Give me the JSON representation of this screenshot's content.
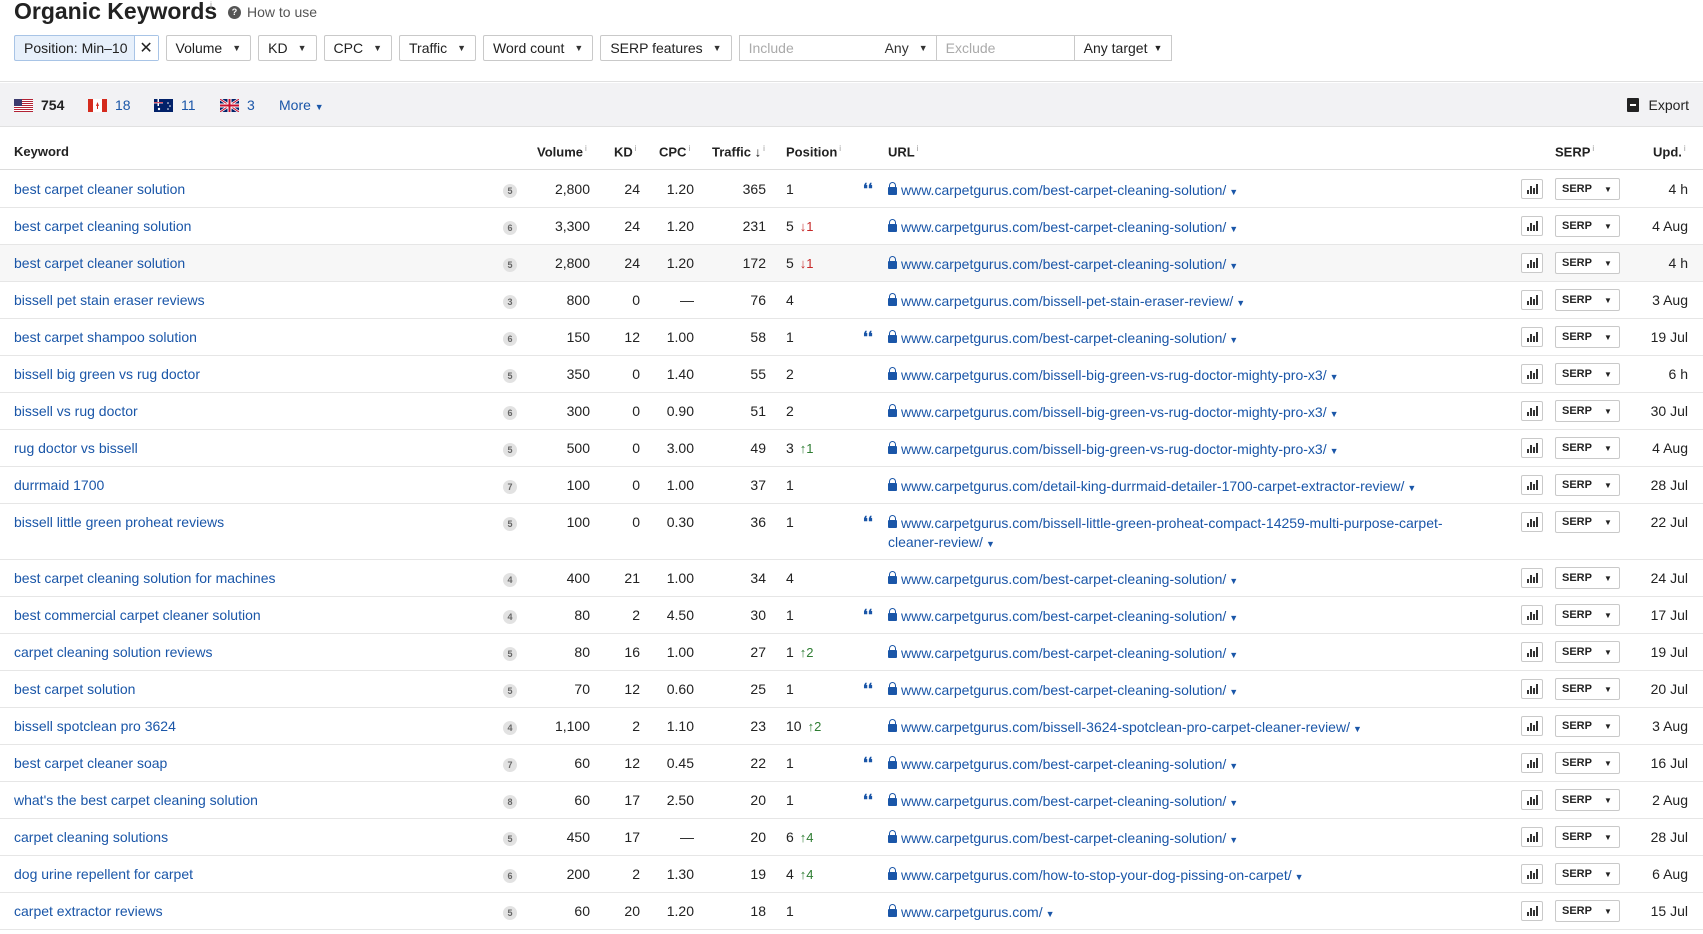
{
  "header": {
    "title": "Organic Keywords",
    "title_sup": "i",
    "how_to_use": "How to use"
  },
  "filters": {
    "position": "Position: Min–10",
    "volume": "Volume",
    "kd": "KD",
    "cpc": "CPC",
    "traffic": "Traffic",
    "word_count": "Word count",
    "serp_features": "SERP features",
    "include_placeholder": "Include",
    "include_mode": "Any",
    "exclude_placeholder": "Exclude",
    "target": "Any target"
  },
  "countries": [
    {
      "code": "US",
      "count": "754"
    },
    {
      "code": "CA",
      "count": "18"
    },
    {
      "code": "AU",
      "count": "11"
    },
    {
      "code": "GB",
      "count": "3"
    }
  ],
  "more_label": "More",
  "export_label": "Export",
  "columns": {
    "keyword": "Keyword",
    "volume": "Volume",
    "kd": "KD",
    "cpc": "CPC",
    "traffic": "Traffic",
    "traffic_sort": "↓",
    "position": "Position",
    "url": "URL",
    "serp": "SERP",
    "upd": "Upd."
  },
  "serp_button": "SERP",
  "rows": [
    {
      "keyword": "best carpet cleaner solution",
      "wc": "5",
      "volume": "2,800",
      "kd": "24",
      "cpc": "1.20",
      "traffic": "365",
      "position": "1",
      "change": "",
      "dir": "",
      "snippet": true,
      "url": "www.carpetgurus.com/best-carpet-cleaning-solution/",
      "upd": "4 h"
    },
    {
      "keyword": "best carpet cleaning solution",
      "wc": "6",
      "volume": "3,300",
      "kd": "24",
      "cpc": "1.20",
      "traffic": "231",
      "position": "5",
      "change": "↓1",
      "dir": "down",
      "snippet": false,
      "url": "www.carpetgurus.com/best-carpet-cleaning-solution/",
      "upd": "4 Aug"
    },
    {
      "keyword": "best carpet cleaner solution",
      "wc": "5",
      "volume": "2,800",
      "kd": "24",
      "cpc": "1.20",
      "traffic": "172",
      "position": "5",
      "change": "↓1",
      "dir": "down",
      "snippet": false,
      "url": "www.carpetgurus.com/best-carpet-cleaning-solution/",
      "upd": "4 h"
    },
    {
      "keyword": "bissell pet stain eraser reviews",
      "wc": "3",
      "volume": "800",
      "kd": "0",
      "cpc": "—",
      "traffic": "76",
      "position": "4",
      "change": "",
      "dir": "",
      "snippet": false,
      "url": "www.carpetgurus.com/bissell-pet-stain-eraser-review/",
      "upd": "3 Aug"
    },
    {
      "keyword": "best carpet shampoo solution",
      "wc": "6",
      "volume": "150",
      "kd": "12",
      "cpc": "1.00",
      "traffic": "58",
      "position": "1",
      "change": "",
      "dir": "",
      "snippet": true,
      "url": "www.carpetgurus.com/best-carpet-cleaning-solution/",
      "upd": "19 Jul"
    },
    {
      "keyword": "bissell big green vs rug doctor",
      "wc": "5",
      "volume": "350",
      "kd": "0",
      "cpc": "1.40",
      "traffic": "55",
      "position": "2",
      "change": "",
      "dir": "",
      "snippet": false,
      "url": "www.carpetgurus.com/bissell-big-green-vs-rug-doctor-mighty-pro-x3/",
      "upd": "6 h"
    },
    {
      "keyword": "bissell vs rug doctor",
      "wc": "6",
      "volume": "300",
      "kd": "0",
      "cpc": "0.90",
      "traffic": "51",
      "position": "2",
      "change": "",
      "dir": "",
      "snippet": false,
      "url": "www.carpetgurus.com/bissell-big-green-vs-rug-doctor-mighty-pro-x3/",
      "upd": "30 Jul"
    },
    {
      "keyword": "rug doctor vs bissell",
      "wc": "5",
      "volume": "500",
      "kd": "0",
      "cpc": "3.00",
      "traffic": "49",
      "position": "3",
      "change": "↑1",
      "dir": "up",
      "snippet": false,
      "url": "www.carpetgurus.com/bissell-big-green-vs-rug-doctor-mighty-pro-x3/",
      "upd": "4 Aug"
    },
    {
      "keyword": "durrmaid 1700",
      "wc": "7",
      "volume": "100",
      "kd": "0",
      "cpc": "1.00",
      "traffic": "37",
      "position": "1",
      "change": "",
      "dir": "",
      "snippet": false,
      "url": "www.carpetgurus.com/detail-king-durrmaid-detailer-1700-carpet-extractor-review/",
      "upd": "28 Jul"
    },
    {
      "keyword": "bissell little green proheat reviews",
      "wc": "5",
      "volume": "100",
      "kd": "0",
      "cpc": "0.30",
      "traffic": "36",
      "position": "1",
      "change": "",
      "dir": "",
      "snippet": true,
      "url": "www.carpetgurus.com/bissell-little-green-proheat-compact-14259-multi-purpose-carpet-cleaner-review/",
      "upd": "22 Jul",
      "tall": true
    },
    {
      "keyword": "best carpet cleaning solution for machines",
      "wc": "4",
      "volume": "400",
      "kd": "21",
      "cpc": "1.00",
      "traffic": "34",
      "position": "4",
      "change": "",
      "dir": "",
      "snippet": false,
      "url": "www.carpetgurus.com/best-carpet-cleaning-solution/",
      "upd": "24 Jul"
    },
    {
      "keyword": "best commercial carpet cleaner solution",
      "wc": "4",
      "volume": "80",
      "kd": "2",
      "cpc": "4.50",
      "traffic": "30",
      "position": "1",
      "change": "",
      "dir": "",
      "snippet": true,
      "url": "www.carpetgurus.com/best-carpet-cleaning-solution/",
      "upd": "17 Jul"
    },
    {
      "keyword": "carpet cleaning solution reviews",
      "wc": "5",
      "volume": "80",
      "kd": "16",
      "cpc": "1.00",
      "traffic": "27",
      "position": "1",
      "change": "↑2",
      "dir": "up",
      "snippet": false,
      "url": "www.carpetgurus.com/best-carpet-cleaning-solution/",
      "upd": "19 Jul"
    },
    {
      "keyword": "best carpet solution",
      "wc": "5",
      "volume": "70",
      "kd": "12",
      "cpc": "0.60",
      "traffic": "25",
      "position": "1",
      "change": "",
      "dir": "",
      "snippet": true,
      "url": "www.carpetgurus.com/best-carpet-cleaning-solution/",
      "upd": "20 Jul"
    },
    {
      "keyword": "bissell spotclean pro 3624",
      "wc": "4",
      "volume": "1,100",
      "kd": "2",
      "cpc": "1.10",
      "traffic": "23",
      "position": "10",
      "change": "↑2",
      "dir": "up",
      "snippet": false,
      "url": "www.carpetgurus.com/bissell-3624-spotclean-pro-carpet-cleaner-review/",
      "upd": "3 Aug"
    },
    {
      "keyword": "best carpet cleaner soap",
      "wc": "7",
      "volume": "60",
      "kd": "12",
      "cpc": "0.45",
      "traffic": "22",
      "position": "1",
      "change": "",
      "dir": "",
      "snippet": true,
      "url": "www.carpetgurus.com/best-carpet-cleaning-solution/",
      "upd": "16 Jul"
    },
    {
      "keyword": "what's the best carpet cleaning solution",
      "wc": "8",
      "volume": "60",
      "kd": "17",
      "cpc": "2.50",
      "traffic": "20",
      "position": "1",
      "change": "",
      "dir": "",
      "snippet": true,
      "url": "www.carpetgurus.com/best-carpet-cleaning-solution/",
      "upd": "2 Aug"
    },
    {
      "keyword": "carpet cleaning solutions",
      "wc": "5",
      "volume": "450",
      "kd": "17",
      "cpc": "—",
      "traffic": "20",
      "position": "6",
      "change": "↑4",
      "dir": "up",
      "snippet": false,
      "url": "www.carpetgurus.com/best-carpet-cleaning-solution/",
      "upd": "28 Jul"
    },
    {
      "keyword": "dog urine repellent for carpet",
      "wc": "6",
      "volume": "200",
      "kd": "2",
      "cpc": "1.30",
      "traffic": "19",
      "position": "4",
      "change": "↑4",
      "dir": "up",
      "snippet": false,
      "url": "www.carpetgurus.com/how-to-stop-your-dog-pissing-on-carpet/",
      "upd": "6 Aug"
    },
    {
      "keyword": "carpet extractor reviews",
      "wc": "5",
      "volume": "60",
      "kd": "20",
      "cpc": "1.20",
      "traffic": "18",
      "position": "1",
      "change": "",
      "dir": "",
      "snippet": false,
      "url": "www.carpetgurus.com/",
      "upd": "15 Jul"
    }
  ]
}
